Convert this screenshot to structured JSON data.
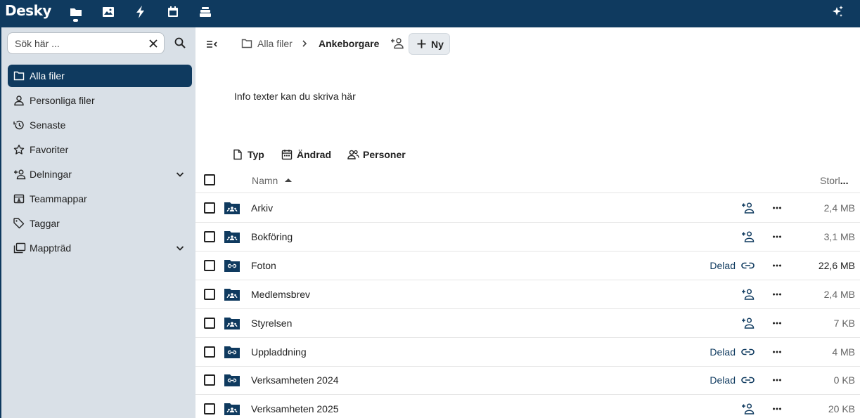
{
  "app": {
    "logo": "Desky"
  },
  "topbar": {
    "apps": [
      {
        "icon": "files-icon",
        "active": true
      },
      {
        "icon": "photos-icon"
      },
      {
        "icon": "activity-icon"
      },
      {
        "icon": "calendar-icon"
      },
      {
        "icon": "deck-icon"
      }
    ],
    "assistant_icon": "sparkles-icon"
  },
  "sidebar": {
    "search_placeholder": "Sök här ...",
    "items": [
      {
        "label": "Alla filer",
        "icon": "folder-icon",
        "active": true
      },
      {
        "label": "Personliga filer",
        "icon": "user-icon"
      },
      {
        "label": "Senaste",
        "icon": "history-icon"
      },
      {
        "label": "Favoriter",
        "icon": "star-icon"
      },
      {
        "label": "Delningar",
        "icon": "share-icon",
        "expandable": true
      },
      {
        "label": "Teammappar",
        "icon": "team-folder-icon"
      },
      {
        "label": "Taggar",
        "icon": "tag-icon"
      },
      {
        "label": "Mappträd",
        "icon": "folder-tree-icon",
        "expandable": true
      }
    ]
  },
  "breadcrumb": {
    "root": "Alla filer",
    "current": "Ankeborgare"
  },
  "new_button": {
    "label": "Ny"
  },
  "info_text": "Info texter kan du skriva här",
  "filters": [
    {
      "label": "Typ",
      "icon": "file-icon"
    },
    {
      "label": "Ändrad",
      "icon": "calendar-icon"
    },
    {
      "label": "Personer",
      "icon": "people-icon"
    }
  ],
  "table": {
    "columns": {
      "name": "Namn",
      "size_prefix": "Storl",
      "size_ellipsis": "..."
    },
    "rows": [
      {
        "name": "Arkiv",
        "folder_type": "team",
        "shared": "",
        "share_icon": "add-user-icon",
        "size": "2,4 MB"
      },
      {
        "name": "Bokföring",
        "folder_type": "team",
        "shared": "",
        "share_icon": "add-user-icon",
        "size": "3,1 MB"
      },
      {
        "name": "Foton",
        "folder_type": "link",
        "shared": "Delad",
        "share_icon": "link-icon",
        "size": "22,6 MB"
      },
      {
        "name": "Medlemsbrev",
        "folder_type": "team",
        "shared": "",
        "share_icon": "add-user-icon",
        "size": "2,4 MB"
      },
      {
        "name": "Styrelsen",
        "folder_type": "team",
        "shared": "",
        "share_icon": "add-user-icon",
        "size": "7 KB"
      },
      {
        "name": "Uppladdning",
        "folder_type": "link",
        "shared": "Delad",
        "share_icon": "link-icon",
        "size": "4 MB"
      },
      {
        "name": "Verksamheten 2024",
        "folder_type": "link",
        "shared": "Delad",
        "share_icon": "link-icon",
        "size": "0 KB"
      },
      {
        "name": "Verksamheten 2025",
        "folder_type": "team",
        "shared": "",
        "share_icon": "add-user-icon",
        "size": "20 KB"
      }
    ]
  },
  "colors": {
    "brand": "#0f3a5f",
    "sidebar_bg": "#d9e0e7",
    "row_border": "#e6e6e6"
  }
}
